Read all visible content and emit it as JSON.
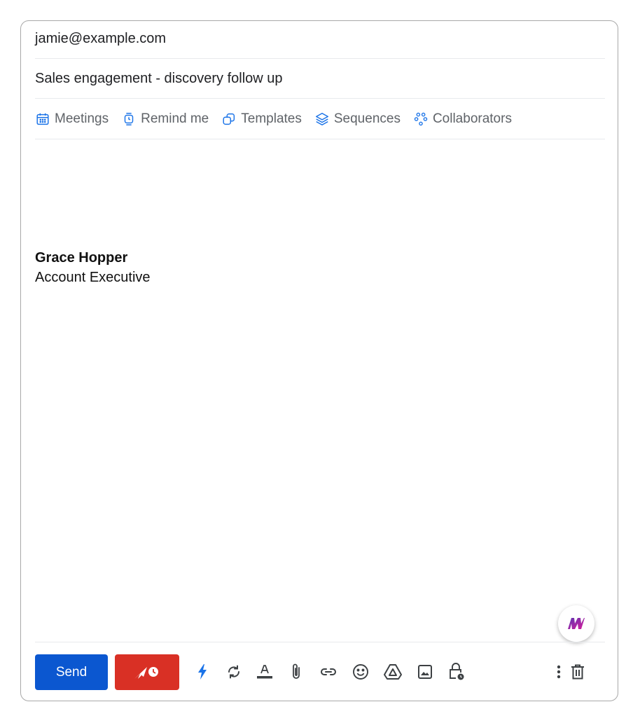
{
  "compose": {
    "to": "jamie@example.com",
    "subject": "Sales engagement - discovery follow up"
  },
  "tools": [
    {
      "label": "Meetings",
      "icon": "calendar-icon"
    },
    {
      "label": "Remind me",
      "icon": "watch-icon"
    },
    {
      "label": "Templates",
      "icon": "templates-icon"
    },
    {
      "label": "Sequences",
      "icon": "layers-icon"
    },
    {
      "label": "Collaborators",
      "icon": "collaborators-icon"
    }
  ],
  "signature": {
    "name": "Grace Hopper",
    "title": "Account Executive"
  },
  "actions": {
    "send_label": "Send"
  },
  "toolbar_icons": [
    "lightning-icon",
    "sync-icon",
    "text-color-icon",
    "attach-icon",
    "link-icon",
    "emoji-icon",
    "drive-icon",
    "image-icon",
    "confidential-lock-icon",
    "more-vert-icon",
    "trash-icon"
  ],
  "colors": {
    "send": "#0b57d0",
    "schedule": "#d93025",
    "tool_icon": "#1a73e8",
    "lightning": "#1a73e8",
    "mixmax_purple": "#8e24aa"
  }
}
